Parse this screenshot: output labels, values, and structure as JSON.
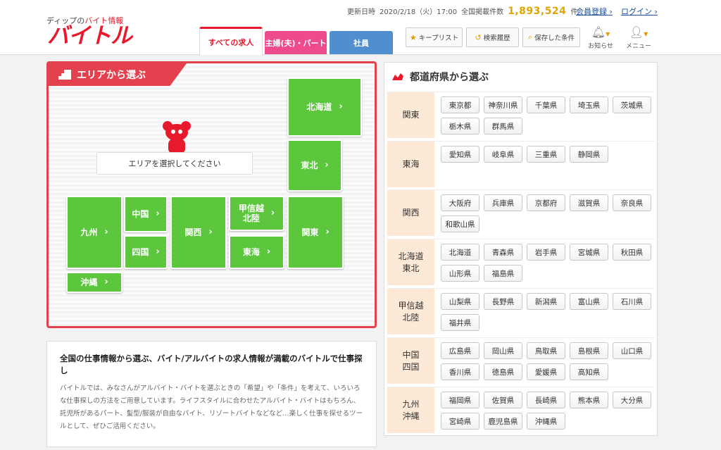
{
  "header": {
    "logo_tagline_prefix": "ディップの",
    "logo_tagline_accent": "バイト情報",
    "logo_text": "バイトル",
    "update_label": "更新日時",
    "update_datetime": "2020/2/18（火）17:00",
    "total_label": "全国掲載件数",
    "total_count": "1,893,524",
    "total_unit": "件",
    "member_register": "会員登録",
    "login": "ログイン",
    "tabs": [
      {
        "label": "すべての求人",
        "color": "#ffffff"
      },
      {
        "label": "主婦(夫)・パート",
        "color": "#ee4b8d"
      },
      {
        "label": "社員",
        "color": "#4f8fd0"
      }
    ],
    "keep_list": "キープリスト",
    "search_history": "検索履歴",
    "saved_conditions": "保存した条件",
    "notifications": "お知らせ",
    "menu": "メニュー"
  },
  "area": {
    "title": "エリアから選ぶ",
    "prompt": "エリアを選択してください",
    "regions": {
      "hokkaido": "北海道",
      "tohoku": "東北",
      "kyushu": "九州",
      "chugoku": "中国",
      "shikoku": "四国",
      "kansai": "関西",
      "koshinetsu": "甲信越\n北陸",
      "tokai": "東海",
      "kanto": "関東",
      "okinawa": "沖縄"
    },
    "accent_color": "#e4414e",
    "region_color": "#5cc63d"
  },
  "info": {
    "heading": "全国の仕事情報から選ぶ、バイト/アルバイトの求人情報が満載のバイトルで仕事探し",
    "body": "バイトルでは、みなさんがアルバイト・バイトを選ぶときの「希望」や「条件」を考えて、いろいろな仕事探しの方法をご用意しています。ライフスタイルに合わせたアルバイト・バイトはもちろん、託児所があるパート、髪型/服装が自由なバイト、リゾートバイトなどなど…楽しく仕事を探せるツールとして、ぜひご活用ください。"
  },
  "prefectures": {
    "title": "都道府県から選ぶ",
    "groups": [
      {
        "region": "関東",
        "items": [
          "東京都",
          "神奈川県",
          "千葉県",
          "埼玉県",
          "茨城県",
          "栃木県",
          "群馬県"
        ]
      },
      {
        "region": "東海",
        "items": [
          "愛知県",
          "岐阜県",
          "三重県",
          "静岡県"
        ]
      },
      {
        "region": "関西",
        "items": [
          "大阪府",
          "兵庫県",
          "京都府",
          "滋賀県",
          "奈良県",
          "和歌山県"
        ]
      },
      {
        "region": "北海道\n東北",
        "items": [
          "北海道",
          "青森県",
          "岩手県",
          "宮城県",
          "秋田県",
          "山形県",
          "福島県"
        ]
      },
      {
        "region": "甲信越\n北陸",
        "items": [
          "山梨県",
          "長野県",
          "新潟県",
          "富山県",
          "石川県",
          "福井県"
        ]
      },
      {
        "region": "中国\n四国",
        "items": [
          "広島県",
          "岡山県",
          "鳥取県",
          "島根県",
          "山口県",
          "香川県",
          "徳島県",
          "愛媛県",
          "高知県"
        ]
      },
      {
        "region": "九州\n沖縄",
        "items": [
          "福岡県",
          "佐賀県",
          "長崎県",
          "熊本県",
          "大分県",
          "宮崎県",
          "鹿児島県",
          "沖縄県"
        ]
      }
    ]
  }
}
